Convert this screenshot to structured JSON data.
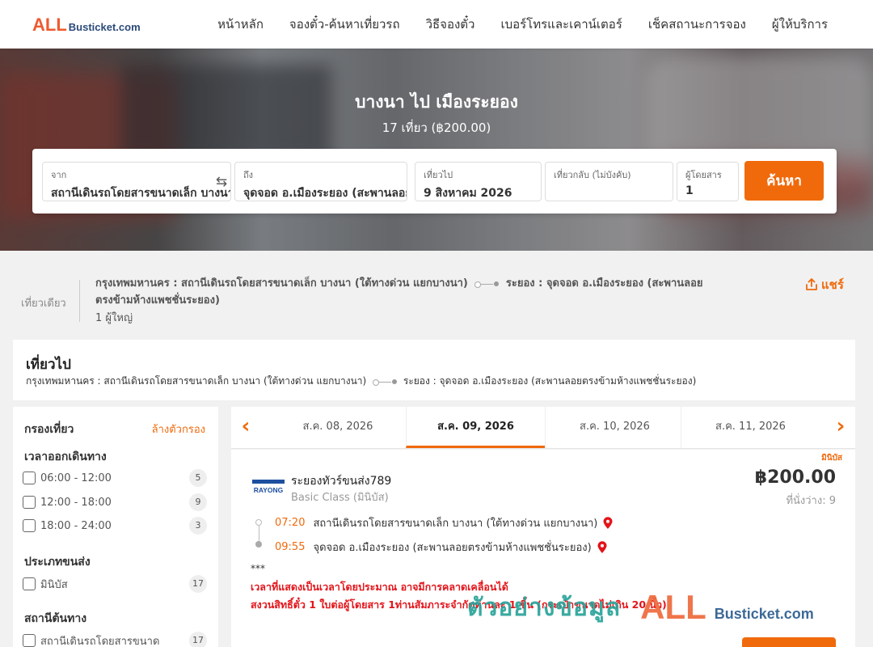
{
  "header": {
    "logo_all": "ALL",
    "logo_rest": "Busticket.com",
    "nav": [
      "หน้าหลัก",
      "จองตั๋ว-ค้นหาเที่ยวรถ",
      "วิธีจองตั๋ว",
      "เบอร์โทรและเคาน์เตอร์",
      "เช็คสถานะการจอง",
      "ผู้ให้บริการ"
    ]
  },
  "hero": {
    "title": "บางนา ไป เมืองระยอง",
    "subtitle": "17 เที่ยว (฿200.00)"
  },
  "search": {
    "from_label": "จาก",
    "from_value": "สถานีเดินรถโดยสารขนาดเล็ก บางนา",
    "to_label": "ถึง",
    "to_value": "จุดจอด อ.เมืองระยอง (สะพานลอย",
    "depart_label": "เที่ยวไป",
    "depart_value": "9 สิงหาคม 2026",
    "return_label": "เที่ยวกลับ (ไม่บังคับ)",
    "return_value": "",
    "pax_label": "ผู้โดยสาร",
    "pax_value": "1",
    "button": "ค้นหา",
    "swap_icon": "swap-arrows-icon"
  },
  "summary": {
    "trip_type": "เที่ยวเดียว",
    "origin": "กรุงเทพมหานคร : สถานีเดินรถโดยสารขนาดเล็ก บางนา (ใต้ทางด่วน แยกบางนา)",
    "destination": "ระยอง : จุดจอด อ.เมืองระยอง (สะพานลอยตรงข้ามห้างแพชชั่นระยอง)",
    "passengers": "1 ผู้ใหญ่",
    "share": "แชร์"
  },
  "outbound": {
    "title": "เที่ยวไป",
    "origin": "กรุงเทพมหานคร : สถานีเดินรถโดยสารขนาดเล็ก บางนา (ใต้ทางด่วน แยกบางนา)",
    "destination": "ระยอง : จุดจอด อ.เมืองระยอง (สะพานลอยตรงข้ามห้างแพชชั่นระยอง)"
  },
  "filters": {
    "title": "กรองเที่ยว",
    "clear": "ล้างตัวกรอง",
    "groups": [
      {
        "title": "เวลาออกเดินทาง",
        "options": [
          {
            "label": "06:00 - 12:00",
            "count": "5"
          },
          {
            "label": "12:00 - 18:00",
            "count": "9"
          },
          {
            "label": "18:00 - 24:00",
            "count": "3"
          }
        ]
      },
      {
        "title": "ประเภทขนส่ง",
        "options": [
          {
            "label": "มินิบัส",
            "count": "17"
          }
        ]
      },
      {
        "title": "สถานีต้นทาง",
        "options": [
          {
            "label": "สถานีเดินรถโดยสารขนาด",
            "count": "17"
          }
        ]
      }
    ]
  },
  "dates": {
    "tabs": [
      "ส.ค. 08, 2026",
      "ส.ค. 09, 2026",
      "ส.ค. 10, 2026",
      "ส.ค. 11, 2026"
    ],
    "active": "ส.ค. 09, 2026"
  },
  "result": {
    "tag": "มินิบัส",
    "logo_text": "RAYONG",
    "operator": "ระยองทัวร์ขนส่ง789",
    "bus_class": "Basic Class (มินิบัส)",
    "price": "฿200.00",
    "seats": "ที่นั่งว่าง: 9",
    "depart_time": "07:20",
    "depart_stop": "สถานีเดินรถโดยสารขนาดเล็ก บางนา (ใต้ทางด่วน แยกบางนา)",
    "arrive_time": "09:55",
    "arrive_stop": "จุดจอด อ.เมืองระยอง (สะพานลอยตรงข้ามห้างแพชชั่นระยอง)",
    "stars": "***",
    "note1": "เวลาที่แสดงเป็นเวลาโดยประมาณ อาจมีการคลาดเคลื่อนได้",
    "note2": "สงวนสิทธิ์ตั๋ว 1 ใบต่อผู้โดยสาร 1ท่านสัมภาระจำกัดท่านละ 1 ชิ้น (กระเป๋าขนาดไม่เกิน 20 นิ้ว)"
  },
  "watermark": {
    "text": "ตัวอย่างข้อมูล",
    "all": "ALL",
    "rest": "Busticket.com"
  },
  "colors": {
    "accent": "#f06a0c",
    "brand_orange": "#ee5a2f",
    "brand_blue": "#2b4a7a",
    "warning_red": "#e3141a"
  }
}
